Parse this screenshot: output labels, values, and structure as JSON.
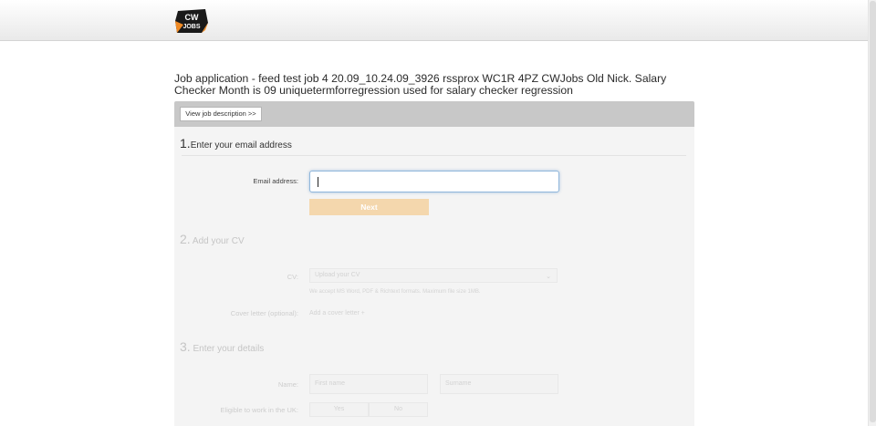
{
  "app": {
    "logo_text_line1": "CW",
    "logo_text_line2": "JOBS"
  },
  "job": {
    "title": "Job application - feed test job 4 20.09_10.24.09_3926 rssprox WC1R 4PZ CWJobs Old Nick. Salary Checker Month is 09 uniquetermforregression used for salary checker regression"
  },
  "toolbar": {
    "view_job_label": "View job description >>"
  },
  "step1": {
    "number": "1.",
    "title": "Enter your email address",
    "email_label": "Email address:",
    "email_value": "",
    "next_label": "Next"
  },
  "step2": {
    "number": "2.",
    "title": "Add your CV",
    "cv_label": "CV:",
    "cv_placeholder": "Upload your CV",
    "cv_hint": "We accept MS Word, PDF & Richtext formats. Maximum file size 1MB.",
    "cover_label": "Cover letter (optional):",
    "cover_link": "Add a cover letter +"
  },
  "step3": {
    "number": "3.",
    "title": "Enter your details",
    "name_label": "Name:",
    "first_name_placeholder": "First name",
    "surname_placeholder": "Surname",
    "eligible_label": "Eligible to work in the UK:",
    "yes_label": "Yes",
    "no_label": "No"
  },
  "colors": {
    "accent": "#f4d7ad",
    "toolbar_bg": "#c8c8c8",
    "form_bg": "#f4f4f4",
    "focus_border": "#8fb6db"
  }
}
